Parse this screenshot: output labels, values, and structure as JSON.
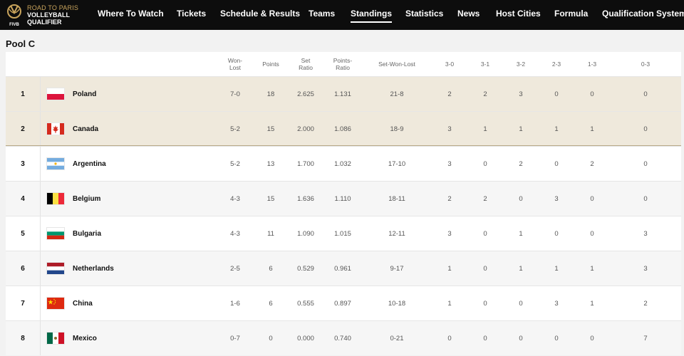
{
  "nav": {
    "logo": {
      "line1": "ROAD TO PARIS",
      "line2": "VOLLEYBALL",
      "line3": "QUALIFIER",
      "mark_text": "FIVB"
    },
    "items": [
      {
        "label": "Where To Watch"
      },
      {
        "label": "Tickets"
      },
      {
        "label": "Schedule & Results"
      },
      {
        "label": "Teams"
      },
      {
        "label": "Standings",
        "active": true
      },
      {
        "label": "Statistics"
      },
      {
        "label": "News"
      },
      {
        "label": "Host Cities"
      },
      {
        "label": "Formula"
      },
      {
        "label": "Qualification System"
      }
    ]
  },
  "pool": {
    "title": "Pool C"
  },
  "table": {
    "headers": {
      "won_lost": "Won-\nLost",
      "points": "Points",
      "set_ratio": "Set\nRatio",
      "points_ratio": "Points-\nRatio",
      "set_won_lost": "Set-Won-Lost",
      "r30": "3-0",
      "r31": "3-1",
      "r32": "3-2",
      "r23": "2-3",
      "r13": "1-3",
      "r03": "0-3"
    },
    "rows": [
      {
        "rank": "1",
        "team": "Poland",
        "flag": "flag-poland-icon",
        "won_lost": "7-0",
        "points": "18",
        "set_ratio": "2.625",
        "points_ratio": "1.131",
        "set_won_lost": "21-8",
        "r30": "2",
        "r31": "2",
        "r32": "3",
        "r23": "0",
        "r13": "0",
        "r03": "0"
      },
      {
        "rank": "2",
        "team": "Canada",
        "flag": "flag-canada-icon",
        "won_lost": "5-2",
        "points": "15",
        "set_ratio": "2.000",
        "points_ratio": "1.086",
        "set_won_lost": "18-9",
        "r30": "3",
        "r31": "1",
        "r32": "1",
        "r23": "1",
        "r13": "1",
        "r03": "0"
      },
      {
        "rank": "3",
        "team": "Argentina",
        "flag": "flag-argentina-icon",
        "won_lost": "5-2",
        "points": "13",
        "set_ratio": "1.700",
        "points_ratio": "1.032",
        "set_won_lost": "17-10",
        "r30": "3",
        "r31": "0",
        "r32": "2",
        "r23": "0",
        "r13": "2",
        "r03": "0"
      },
      {
        "rank": "4",
        "team": "Belgium",
        "flag": "flag-belgium-icon",
        "won_lost": "4-3",
        "points": "15",
        "set_ratio": "1.636",
        "points_ratio": "1.110",
        "set_won_lost": "18-11",
        "r30": "2",
        "r31": "2",
        "r32": "0",
        "r23": "3",
        "r13": "0",
        "r03": "0"
      },
      {
        "rank": "5",
        "team": "Bulgaria",
        "flag": "flag-bulgaria-icon",
        "won_lost": "4-3",
        "points": "11",
        "set_ratio": "1.090",
        "points_ratio": "1.015",
        "set_won_lost": "12-11",
        "r30": "3",
        "r31": "0",
        "r32": "1",
        "r23": "0",
        "r13": "0",
        "r03": "3"
      },
      {
        "rank": "6",
        "team": "Netherlands",
        "flag": "flag-netherlands-icon",
        "won_lost": "2-5",
        "points": "6",
        "set_ratio": "0.529",
        "points_ratio": "0.961",
        "set_won_lost": "9-17",
        "r30": "1",
        "r31": "0",
        "r32": "1",
        "r23": "1",
        "r13": "1",
        "r03": "3"
      },
      {
        "rank": "7",
        "team": "China",
        "flag": "flag-china-icon",
        "won_lost": "1-6",
        "points": "6",
        "set_ratio": "0.555",
        "points_ratio": "0.897",
        "set_won_lost": "10-18",
        "r30": "1",
        "r31": "0",
        "r32": "0",
        "r23": "3",
        "r13": "1",
        "r03": "2"
      },
      {
        "rank": "8",
        "team": "Mexico",
        "flag": "flag-mexico-icon",
        "won_lost": "0-7",
        "points": "0",
        "set_ratio": "0.000",
        "points_ratio": "0.740",
        "set_won_lost": "0-21",
        "r30": "0",
        "r31": "0",
        "r32": "0",
        "r23": "0",
        "r13": "0",
        "r03": "7"
      }
    ]
  },
  "colors": {
    "nav_bg": "#0d0d0d",
    "logo_gold": "#c9a45c",
    "qualified_row_bg": "#efe9dc",
    "qualified_divider": "#b8a888"
  }
}
